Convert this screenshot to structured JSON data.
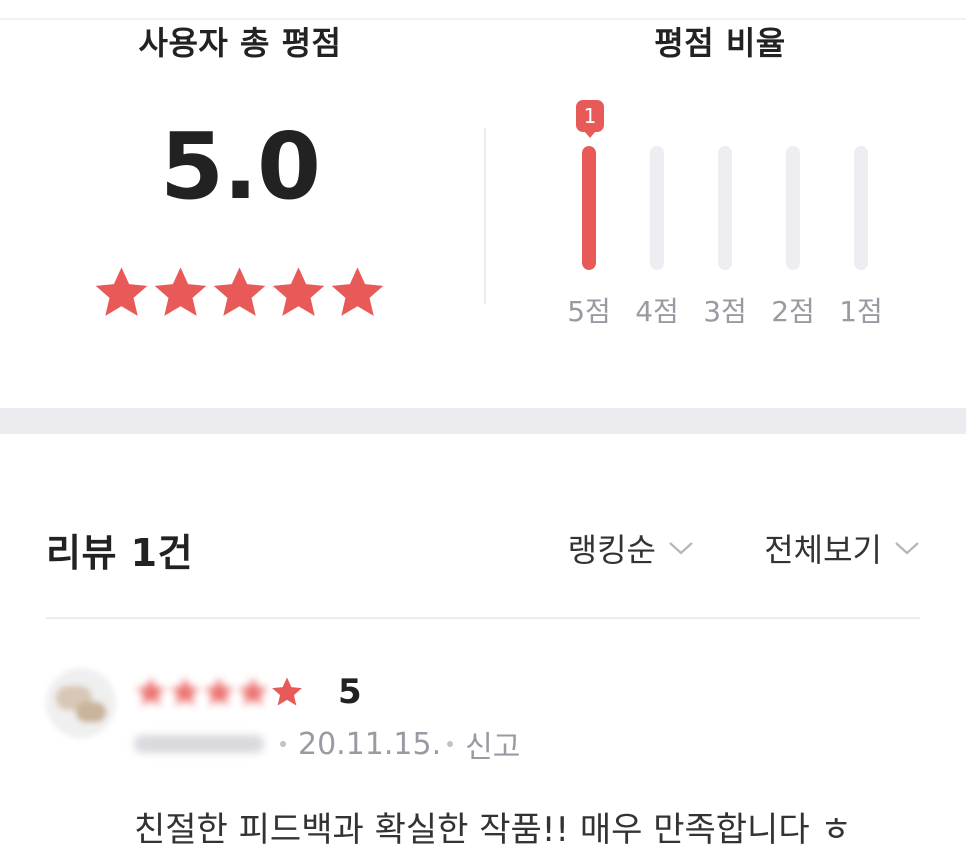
{
  "summary": {
    "title": "사용자 총 평점",
    "score": "5.0",
    "stars": 5
  },
  "ratio": {
    "title": "평점 비율",
    "bars": [
      {
        "label": "5점",
        "fraction": 1.0,
        "badge": "1"
      },
      {
        "label": "4점",
        "fraction": 0.0,
        "badge": ""
      },
      {
        "label": "3점",
        "fraction": 0.0,
        "badge": ""
      },
      {
        "label": "2점",
        "fraction": 0.0,
        "badge": ""
      },
      {
        "label": "1점",
        "fraction": 0.0,
        "badge": ""
      }
    ]
  },
  "reviews_header": {
    "title": "리뷰 1건",
    "sort_label": "랭킹순",
    "filter_label": "전체보기"
  },
  "review": {
    "score": "5",
    "date": "20.11.15.",
    "report_label": "신고",
    "text": "친절한 피드백과 확실한 작품!! 매우 만족합니다 ㅎ"
  },
  "colors": {
    "accent": "#e85a58",
    "track": "#eeeef2",
    "muted_text": "#9a9aa2"
  }
}
